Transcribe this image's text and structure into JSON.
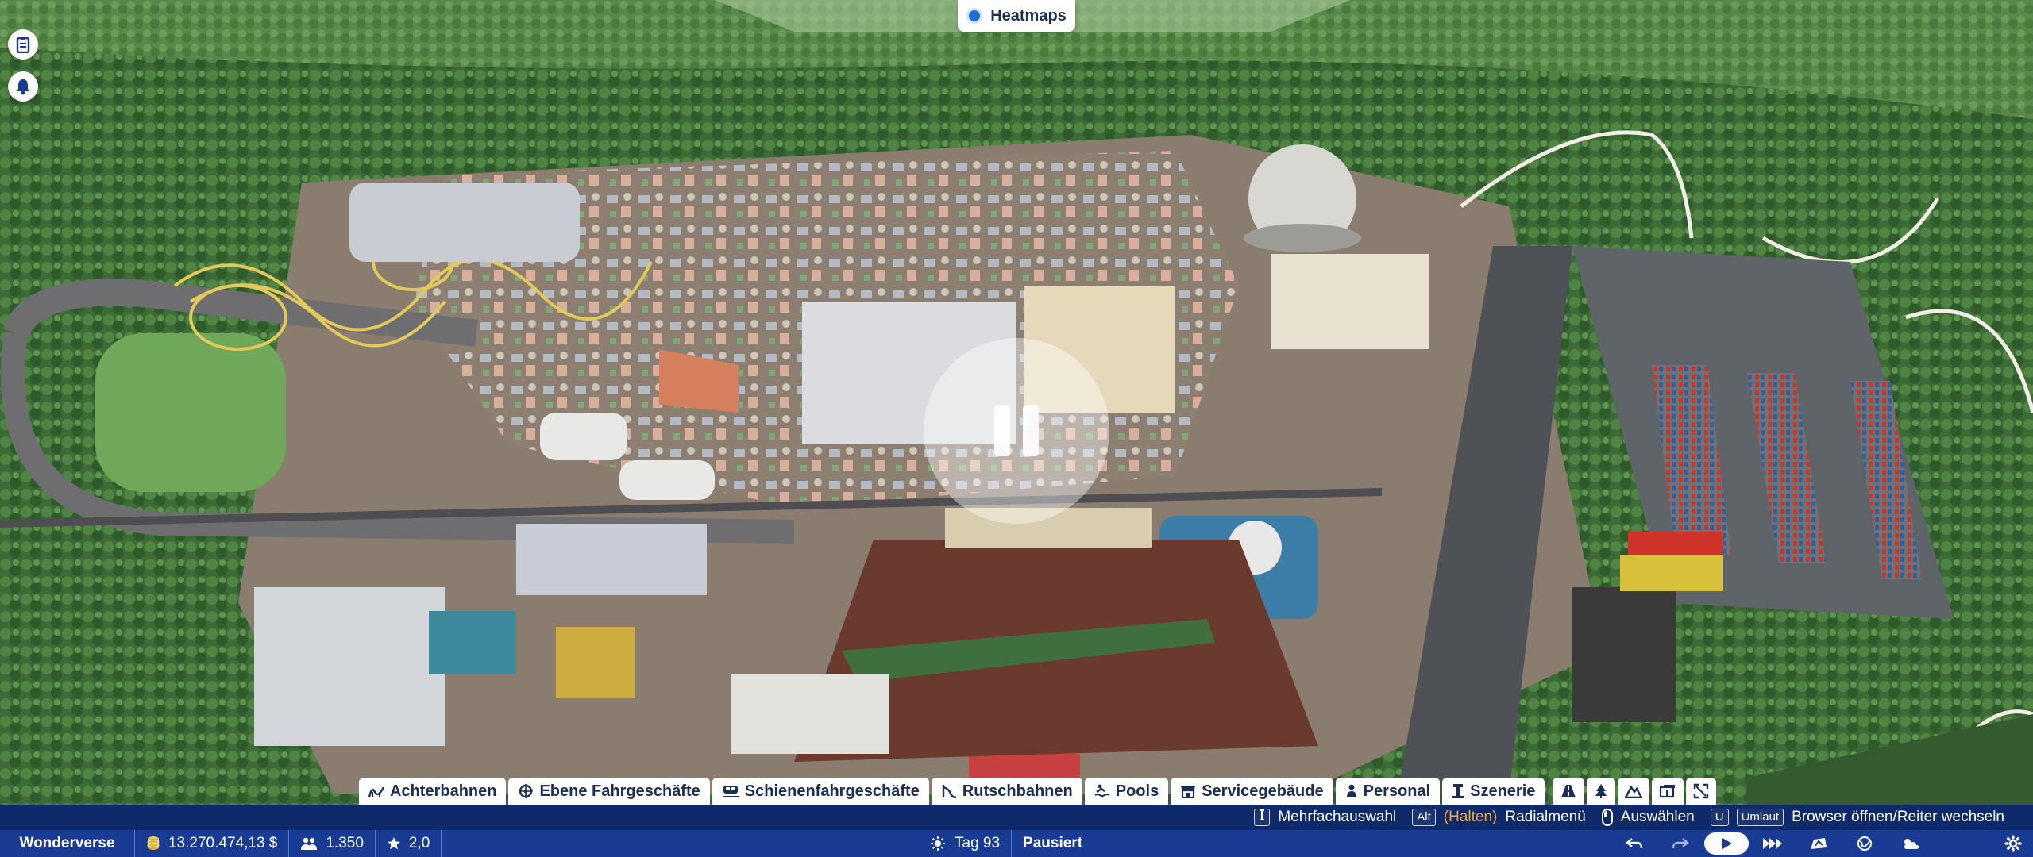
{
  "heatmaps": {
    "label": "Heatmaps"
  },
  "left_tools": [
    "clipboard-icon",
    "bell-icon"
  ],
  "categories": [
    {
      "label": "Achterbahnen",
      "icon": "coaster-icon"
    },
    {
      "label": "Ebene Fahrgeschäfte",
      "icon": "flat-ride-icon"
    },
    {
      "label": "Schienenfahrgeschäfte",
      "icon": "track-ride-icon"
    },
    {
      "label": "Rutschbahnen",
      "icon": "slide-icon"
    },
    {
      "label": "Pools",
      "icon": "pool-icon"
    },
    {
      "label": "Servicegebäude",
      "icon": "shop-icon"
    },
    {
      "label": "Personal",
      "icon": "staff-icon"
    },
    {
      "label": "Szenerie",
      "icon": "scenery-icon"
    }
  ],
  "category_tools": [
    "path-icon",
    "tree-icon",
    "terrain-icon",
    "blueprint-icon",
    "resize-icon"
  ],
  "hints": {
    "multi_key_icon": "multi-select-icon",
    "multi_label": "Mehrfachauswahl",
    "alt_key": "Alt",
    "hold_label": "(Halten)",
    "radial_label": "Radialmenü",
    "select_label": "Auswählen",
    "u_key": "U",
    "umlaut_key": "Umlaut",
    "browser_label": "Browser öffnen/Reiter wechseln"
  },
  "status": {
    "park_name": "Wonderverse",
    "money": "13.270.474,13 $",
    "guests": "1.350",
    "rating": "2,0",
    "day": "Tag 93",
    "paused": "Pausiert"
  },
  "speed_controls": [
    "undo-icon",
    "redo-icon",
    "play-icon",
    "fast-forward-icon",
    "camera-icon",
    "globe-icon",
    "weather-icon"
  ],
  "settings_icon": "gear-icon",
  "colors": {
    "hint_bar": "#0e2a6b",
    "status_bar": "#1a3b93",
    "hold": "#f0a83a",
    "chip_text": "#1b2c55"
  }
}
